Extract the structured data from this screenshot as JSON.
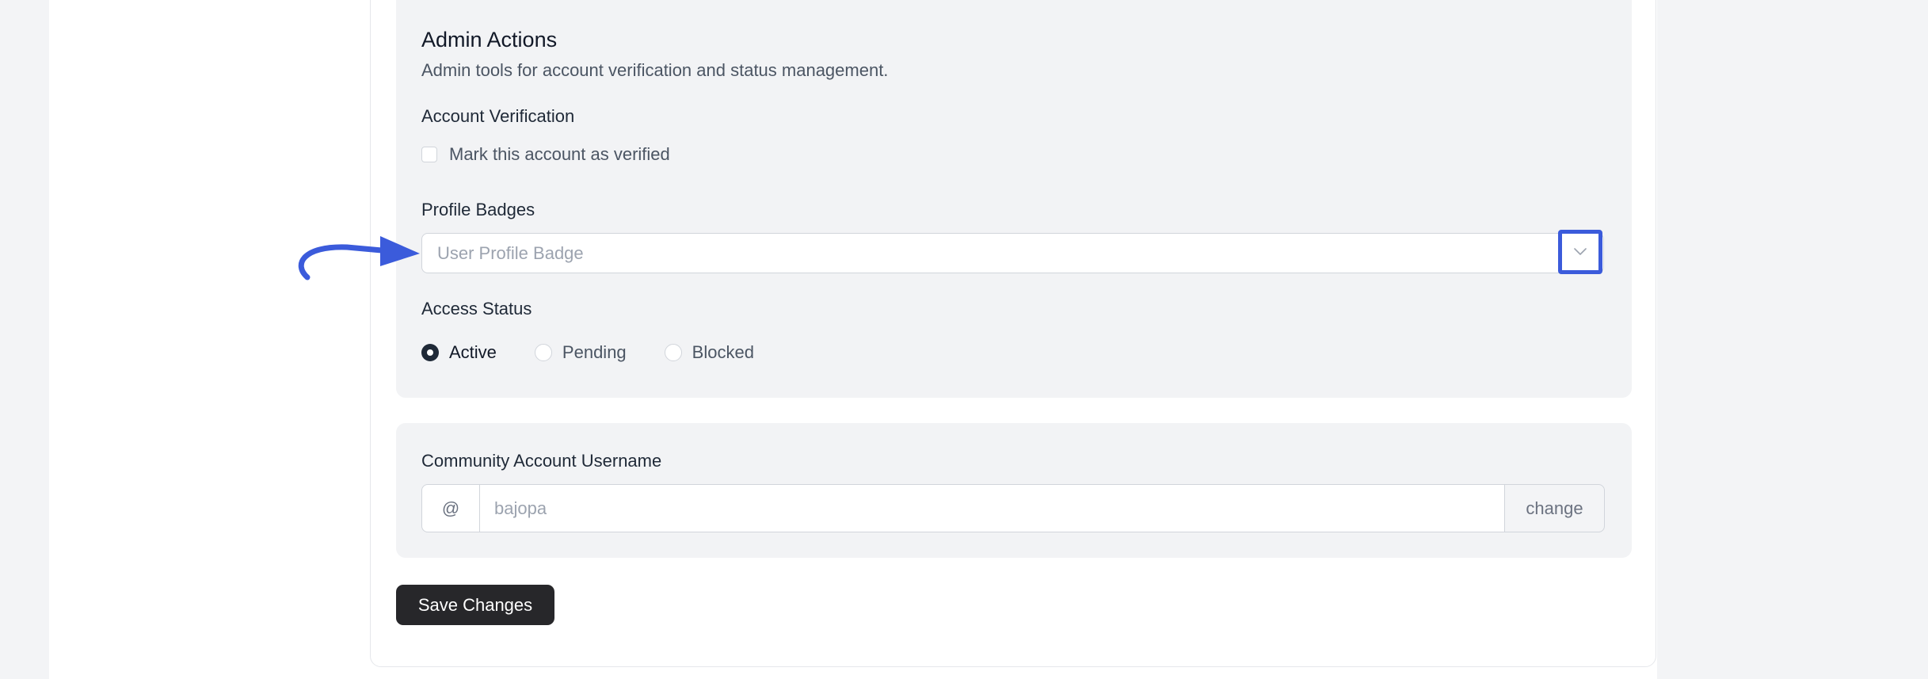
{
  "admin_actions": {
    "title": "Admin Actions",
    "description": "Admin tools for account verification and status management.",
    "verification": {
      "label": "Account Verification",
      "checkbox_label": "Mark this account as verified",
      "checked": false
    },
    "badges": {
      "label": "Profile Badges",
      "placeholder": "User Profile Badge",
      "chevron_icon": "chevron-down-icon"
    },
    "access_status": {
      "label": "Access Status",
      "options": [
        {
          "label": "Active",
          "checked": true
        },
        {
          "label": "Pending",
          "checked": false
        },
        {
          "label": "Blocked",
          "checked": false
        }
      ]
    }
  },
  "community": {
    "label": "Community Account Username",
    "prefix": "@",
    "placeholder": "bajopa",
    "change_label": "change"
  },
  "save_label": "Save Changes",
  "colors": {
    "annotation": "#3b5bdb",
    "primary_button": "#27272a",
    "card_background": "#f2f3f5"
  }
}
